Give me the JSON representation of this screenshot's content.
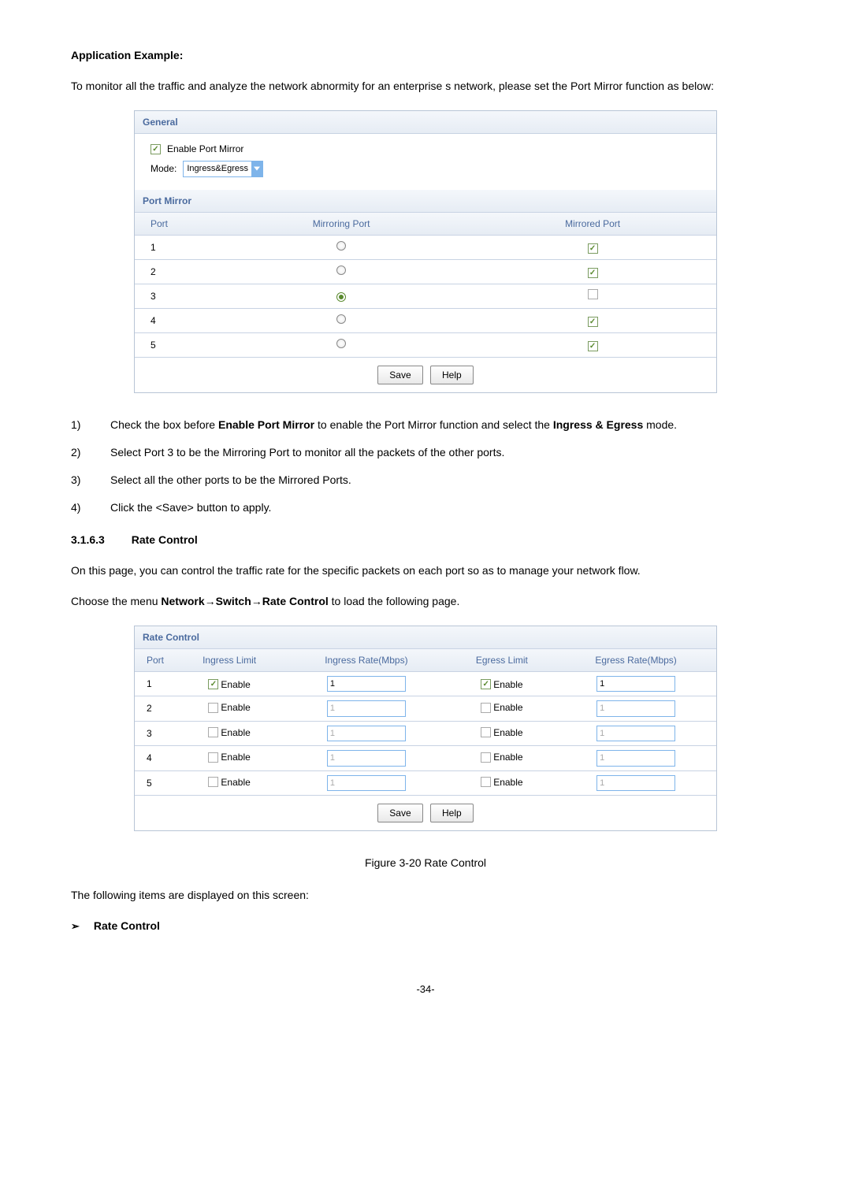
{
  "heading": "Application Example:",
  "intro": "To monitor all the traffic and analyze the network abnormity for an enterprise s network, please set the Port Mirror function as below:",
  "screenshot1": {
    "general_label": "General",
    "enable_label": "Enable Port Mirror",
    "mode_label": "Mode:",
    "mode_value": "Ingress&Egress",
    "port_mirror_label": "Port Mirror",
    "headers": {
      "port": "Port",
      "mirroring": "Mirroring Port",
      "mirrored": "Mirrored Port"
    },
    "rows": [
      {
        "port": "1",
        "mirroring": false,
        "mirrored": true
      },
      {
        "port": "2",
        "mirroring": false,
        "mirrored": true
      },
      {
        "port": "3",
        "mirroring": true,
        "mirrored": false
      },
      {
        "port": "4",
        "mirroring": false,
        "mirrored": true
      },
      {
        "port": "5",
        "mirroring": false,
        "mirrored": true
      }
    ],
    "save": "Save",
    "help": "Help"
  },
  "instructions": [
    {
      "num": "1)",
      "pre": "Check the box before ",
      "bold1": "Enable Port Mirror",
      "mid": " to enable the Port Mirror function and select the ",
      "bold2": "Ingress & Egress",
      "post": " mode."
    },
    {
      "num": "2)",
      "text": "Select Port 3 to be the Mirroring Port to monitor all the packets of the other ports."
    },
    {
      "num": "3)",
      "text": "Select all the other ports to be the Mirrored Ports."
    },
    {
      "num": "4)",
      "text": "Click the <Save> button to apply."
    }
  ],
  "sub_heading": {
    "num": "3.1.6.3",
    "title": "Rate Control"
  },
  "rc_intro": "On this page, you can control the traffic rate for the specific packets on each port so as to manage your network flow.",
  "menu_line": {
    "pre": "Choose the menu ",
    "bold": "Network→Switch→Rate Control",
    "post": " to load the following page."
  },
  "screenshot2": {
    "title": "Rate Control",
    "headers": {
      "port": "Port",
      "il": "Ingress Limit",
      "ir": "Ingress Rate(Mbps)",
      "el": "Egress Limit",
      "er": "Egress Rate(Mbps)"
    },
    "enable": "Enable",
    "rows": [
      {
        "port": "1",
        "il": true,
        "ir": "1",
        "el": true,
        "er": "1"
      },
      {
        "port": "2",
        "il": false,
        "ir": "1",
        "el": false,
        "er": "1"
      },
      {
        "port": "3",
        "il": false,
        "ir": "1",
        "el": false,
        "er": "1"
      },
      {
        "port": "4",
        "il": false,
        "ir": "1",
        "el": false,
        "er": "1"
      },
      {
        "port": "5",
        "il": false,
        "ir": "1",
        "el": false,
        "er": "1"
      }
    ],
    "save": "Save",
    "help": "Help"
  },
  "figure_caption": "Figure 3-20 Rate Control",
  "displayed": "The following items are displayed on this screen:",
  "bullet": "Rate Control",
  "page_number": "-34-"
}
